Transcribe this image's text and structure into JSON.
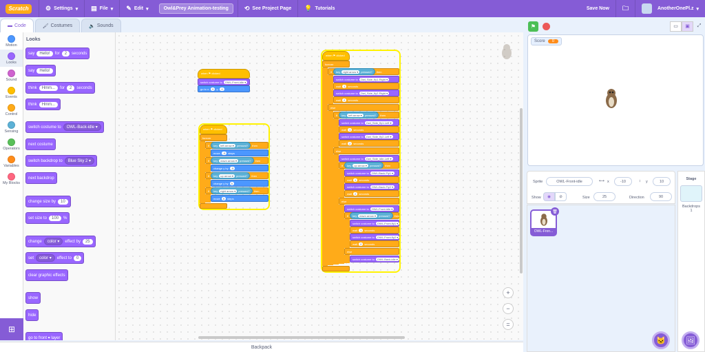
{
  "menubar": {
    "logo": "Scratch",
    "settings": "Settings",
    "file": "File",
    "edit": "Edit",
    "project_title": "Owl&Prey Animation-testing",
    "see_project_page": "See Project Page",
    "tutorials": "Tutorials",
    "save_now": "Save Now",
    "username": "AnotherOnePl.z"
  },
  "tabs": [
    "Code",
    "Costumes",
    "Sounds"
  ],
  "categories": [
    {
      "label": "Motion",
      "color": "#4c97ff"
    },
    {
      "label": "Looks",
      "color": "#9966ff"
    },
    {
      "label": "Sound",
      "color": "#cf63cf"
    },
    {
      "label": "Events",
      "color": "#ffbf00"
    },
    {
      "label": "Control",
      "color": "#ffab19"
    },
    {
      "label": "Sensing",
      "color": "#5cb1d6"
    },
    {
      "label": "Operators",
      "color": "#59c059"
    },
    {
      "label": "Variables",
      "color": "#ff8c1a"
    },
    {
      "label": "My Blocks",
      "color": "#ff6680"
    }
  ],
  "palette": {
    "title": "Looks",
    "say_for": {
      "a": "say",
      "msg": "Hello!",
      "b": "for",
      "n": "2",
      "c": "seconds"
    },
    "say": {
      "a": "say",
      "msg": "Hello!"
    },
    "think_for": {
      "a": "think",
      "msg": "Hmm...",
      "b": "for",
      "n": "2",
      "c": "seconds"
    },
    "think": {
      "a": "think",
      "msg": "Hmm..."
    },
    "switch_costume": {
      "a": "switch costume to",
      "v": "OWL-Back-idle ▾"
    },
    "next_costume": "next costume",
    "switch_backdrop": {
      "a": "switch backdrop to",
      "v": "Blue Sky 2 ▾"
    },
    "next_backdrop": "next backdrop",
    "change_size": {
      "a": "change size by",
      "v": "10"
    },
    "set_size": {
      "a": "set size to",
      "v": "100",
      "b": "%"
    },
    "change_effect": {
      "a": "change",
      "v": "color ▾",
      "b": "effect by",
      "n": "25"
    },
    "set_effect": {
      "a": "set",
      "v": "color ▾",
      "b": "effect to",
      "n": "0"
    },
    "clear_effects": "clear graphic effects",
    "show": "show",
    "hide": "hide",
    "goto_front": "go to front ▾ layer"
  },
  "scripts": {
    "s1": {
      "hat": "when ⚑ clicked",
      "costume": "switch costume to",
      "costume_v": "OWL-Front-idle ▾",
      "goto": "go to x:",
      "x": "0",
      "y_lbl": "y:",
      "y": "0"
    },
    "s2": {
      "hat": "when ⚑ clicked",
      "forever": "forever",
      "if": "if",
      "key": "key",
      "pressed": "pressed?",
      "then": "then",
      "left": "left arrow ▾",
      "down": "down arrow ▾",
      "up": "up arrow ▾",
      "right": "right arrow ▾",
      "move": "move",
      "steps": "steps",
      "neg5": "-5",
      "pos5": "5",
      "change_y": "change y by"
    },
    "s3": {
      "hat": "when ⚑ clicked",
      "forever": "forever",
      "if": "if",
      "else": "else",
      "key": "key",
      "pressed": "pressed?",
      "then": "then",
      "right": "right arrow ▾",
      "left": "left arrow ▾",
      "up": "up arrow ▾",
      "down": "down arrow ▾",
      "costume": "switch costume to",
      "wait": "wait",
      "seconds": "seconds",
      "w1": "1",
      "w2": "2",
      "c_side_fly1_right": "Owl_Side_fly1-Right ▾",
      "c_side_fly2_right": "Owl_Side_fly2-Right ▾",
      "c_side_fly1_left": "Owl_Side_fly1-Left ▾",
      "c_side_fly2_left": "Owl_Side_fly2-Left ▾",
      "c_side_idle_left": "Owl_Side_idle-Left ▾",
      "c_back_fly1": "OWL-Back-Fly1 ▾",
      "c_back_fly2": "OWL-Back-Fly2 ▾",
      "c_front_idle": "OWL-Front-idle ▾",
      "c_front_fly1": "OWL-Front-fly1 ▾",
      "c_front_fly2": "OWL-Front-fly2 ▾",
      "c_back_idle": "OWL-Back-idle ▾"
    }
  },
  "zoom": {
    "in": "+",
    "out": "−",
    "reset": "="
  },
  "backpack": "Backpack",
  "stage": {
    "monitor_label": "Score",
    "monitor_value": "0"
  },
  "sprite_info": {
    "sprite_label": "Sprite",
    "sprite_name": "OWL-Front-idle",
    "x_label": "x",
    "x": "-10",
    "y_label": "y",
    "y": "10",
    "show_label": "Show",
    "size_label": "Size",
    "size": "25",
    "direction_label": "Direction",
    "direction": "90"
  },
  "sprite_tile": {
    "name": "OWL-Fron..."
  },
  "stage_panel": {
    "title": "Stage",
    "backdrops_label": "Backdrops",
    "backdrops_count": "1"
  }
}
